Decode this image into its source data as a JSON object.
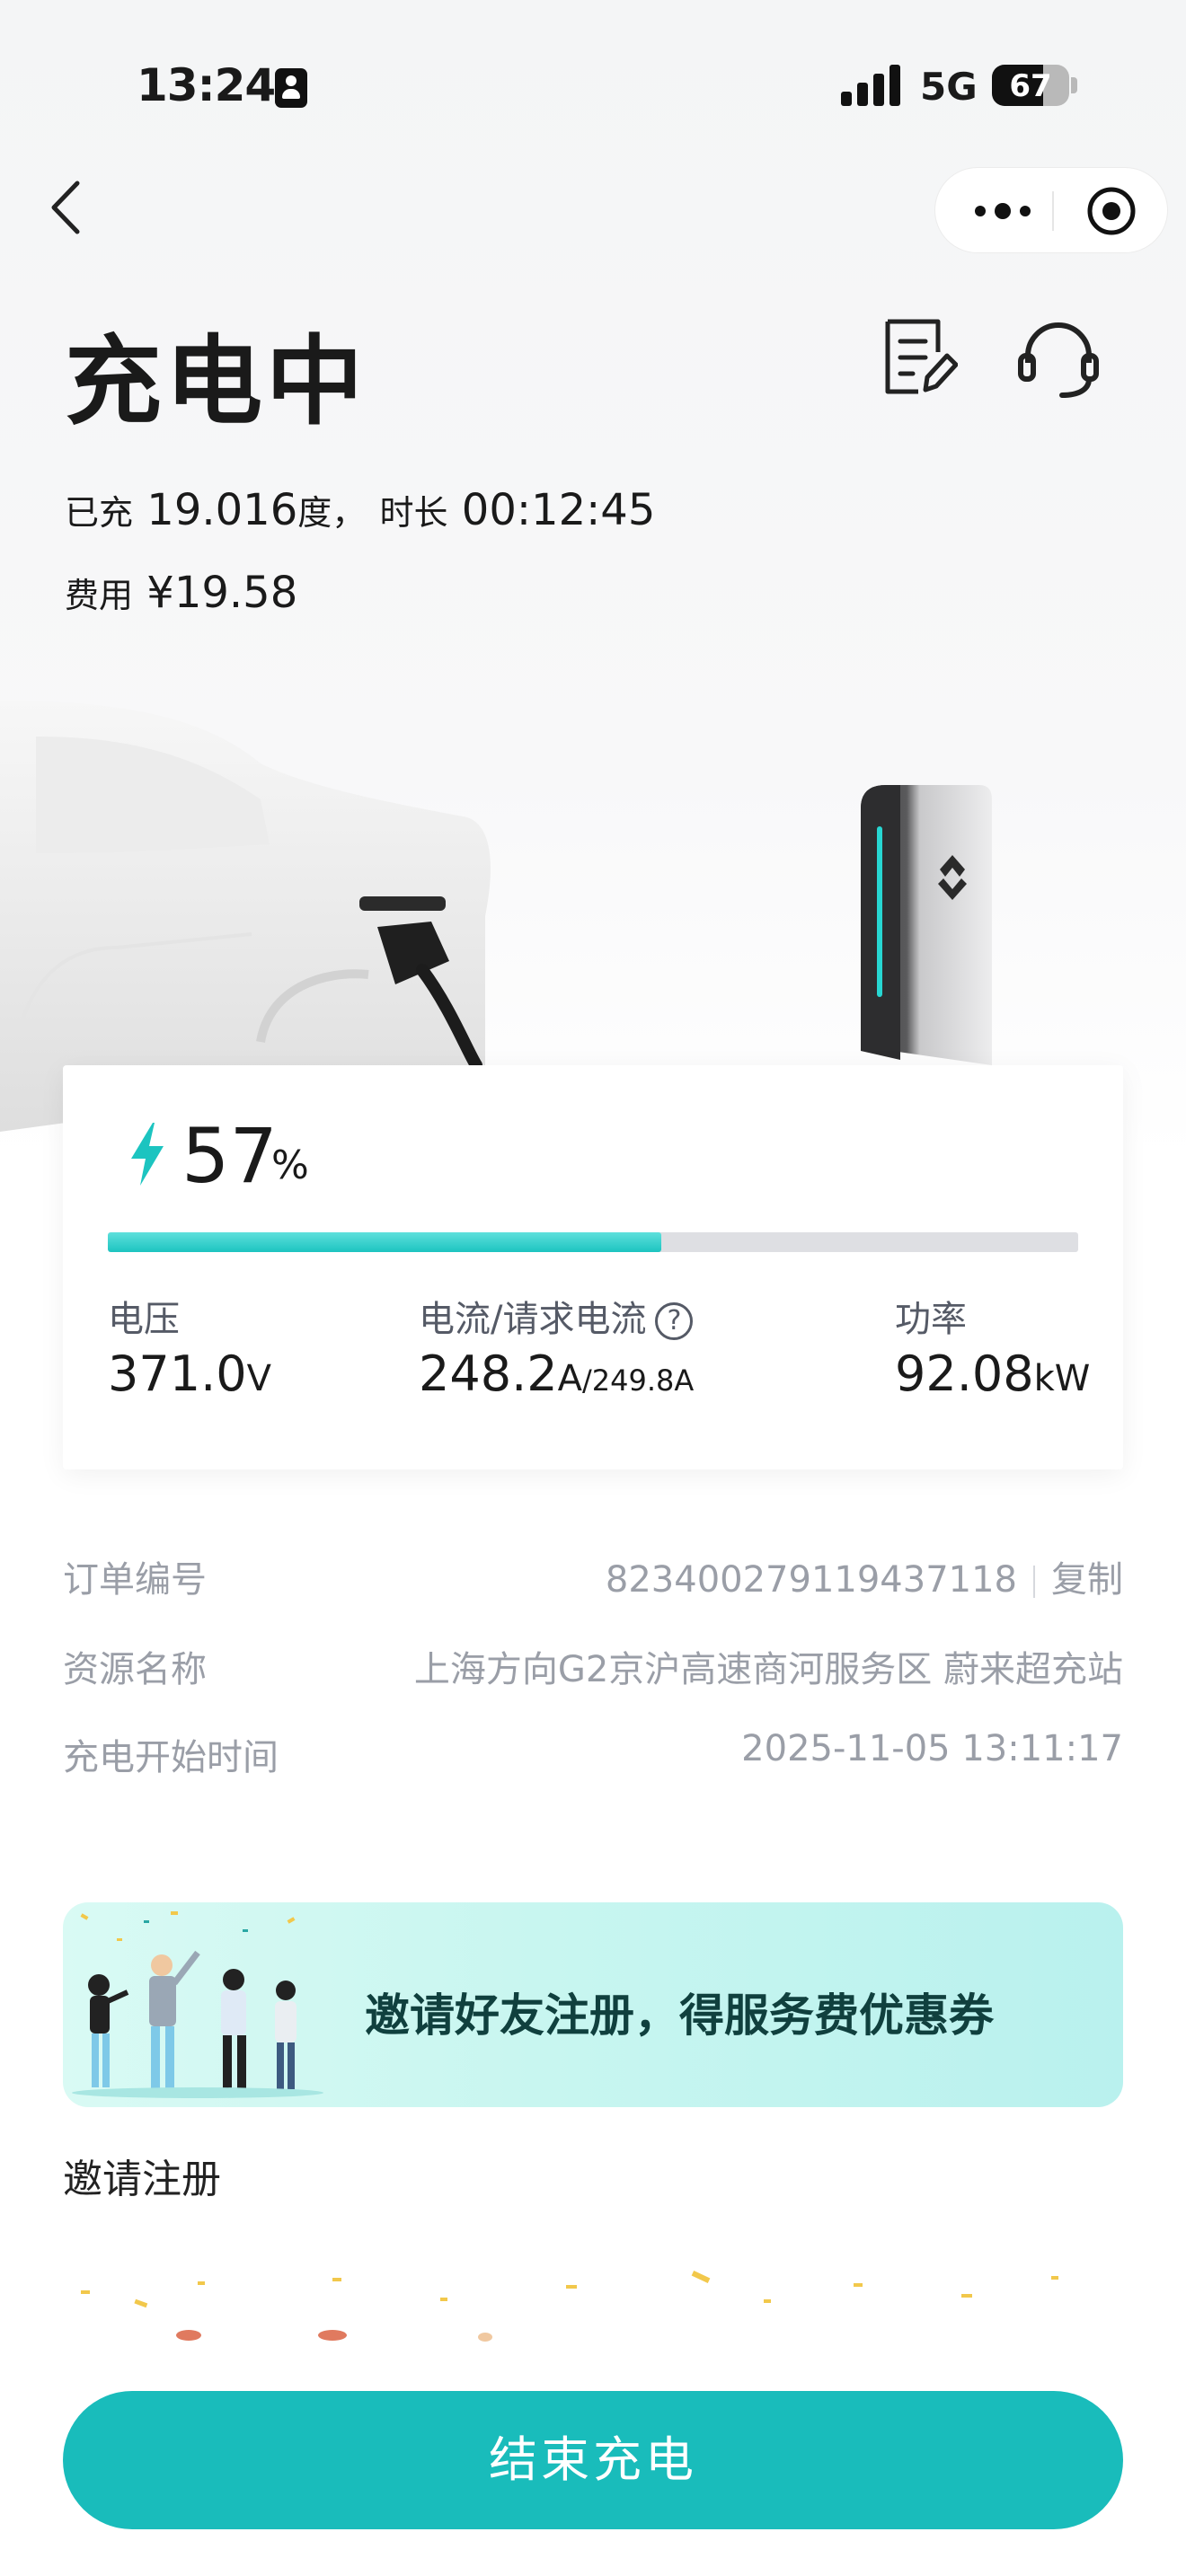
{
  "status_bar": {
    "time": "13:24",
    "network": "5G",
    "battery": "67"
  },
  "header": {
    "title": "充电中"
  },
  "summary": {
    "charged_label": "已充",
    "charged_value": "19.016",
    "charged_unit": "度，",
    "duration_label": "时长",
    "duration_value": "00:12:45",
    "cost_label": "费用",
    "cost_value": "¥19.58"
  },
  "progress": {
    "percent": "57",
    "percent_unit": "%",
    "fill_fraction": 0.57
  },
  "metrics": {
    "voltage": {
      "label": "电压",
      "value": "371.0",
      "unit": "V"
    },
    "current": {
      "label": "电流/请求电流",
      "value": "248.2",
      "unit": "A",
      "request": "/249.8A"
    },
    "power": {
      "label": "功率",
      "value": "92.08",
      "unit": "kW"
    }
  },
  "help_icon": "?",
  "order": {
    "number_label": "订单编号",
    "number_value": "823400279119437118",
    "copy_label": "复制",
    "resource_label": "资源名称",
    "resource_value": "上海方向G2京沪高速商河服务区 蔚来超充站",
    "start_label": "充电开始时间",
    "start_value": "2025-11-05 13:11:17"
  },
  "banner": {
    "text": "邀请好友注册，得服务费优惠券"
  },
  "invite": {
    "label": "邀请注册"
  },
  "end_button": {
    "label": "结束充电"
  },
  "colors": {
    "accent": "#19bcbb",
    "progress": "#1cc4c0",
    "led": "#27d6d2"
  },
  "icons": [
    "back-icon",
    "more-icon",
    "target-icon",
    "edit-icon",
    "headset-icon",
    "bolt-icon",
    "help-icon"
  ]
}
